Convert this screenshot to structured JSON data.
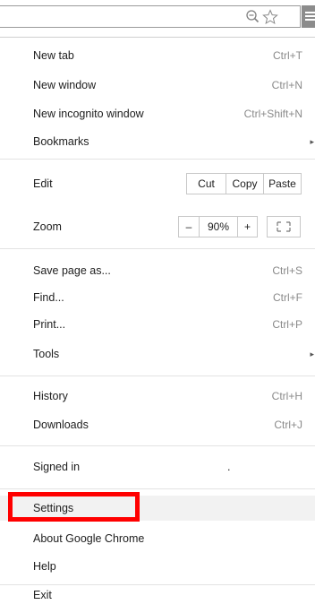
{
  "toolbar": {
    "zoom_icon": "magnifier-minus-icon",
    "star_icon": "bookmark-star-icon",
    "menu_icon": "hamburger-menu-icon"
  },
  "menu": {
    "new_tab": {
      "label": "New tab",
      "shortcut": "Ctrl+T"
    },
    "new_window": {
      "label": "New window",
      "shortcut": "Ctrl+N"
    },
    "new_incognito": {
      "label": "New incognito window",
      "shortcut": "Ctrl+Shift+N"
    },
    "bookmarks": {
      "label": "Bookmarks",
      "arrow": "▸"
    },
    "edit": {
      "label": "Edit",
      "cut": "Cut",
      "copy": "Copy",
      "paste": "Paste"
    },
    "zoom": {
      "label": "Zoom",
      "minus": "–",
      "level": "90%",
      "plus": "+",
      "fullscreen_icon": "fullscreen-icon"
    },
    "save_page": {
      "label": "Save page as...",
      "shortcut": "Ctrl+S"
    },
    "find": {
      "label": "Find...",
      "shortcut": "Ctrl+F"
    },
    "print": {
      "label": "Print...",
      "shortcut": "Ctrl+P"
    },
    "tools": {
      "label": "Tools",
      "arrow": "▸"
    },
    "history": {
      "label": "History",
      "shortcut": "Ctrl+H"
    },
    "downloads": {
      "label": "Downloads",
      "shortcut": "Ctrl+J"
    },
    "signed_in": {
      "label": "Signed in ",
      "suffix": "."
    },
    "settings": {
      "label": "Settings"
    },
    "about": {
      "label": "About Google Chrome"
    },
    "help": {
      "label": "Help"
    },
    "exit": {
      "label": "Exit"
    }
  },
  "colors": {
    "highlight": "#ff0000",
    "shortcut_text": "#8a8a8a"
  }
}
